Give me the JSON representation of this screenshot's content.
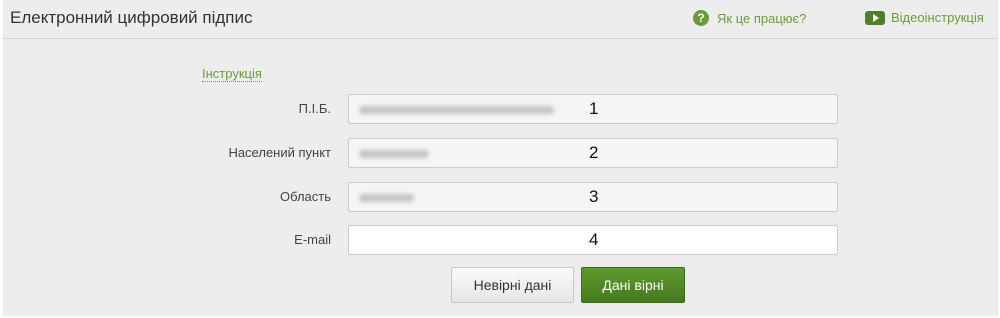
{
  "header": {
    "title": "Електронний цифровий підпис",
    "help_label": "Як це працює?",
    "video_label": "Відеоінструкція"
  },
  "form": {
    "instruction_link": "Інструкція",
    "fields": [
      {
        "label": "П.І.Б.",
        "marker": "1"
      },
      {
        "label": "Населений пункт",
        "marker": "2"
      },
      {
        "label": "Область",
        "marker": "3"
      },
      {
        "label": "E-mail",
        "marker": "4"
      }
    ]
  },
  "buttons": {
    "wrong_label": "Невірні дані",
    "correct_label": "Дані вірні"
  },
  "colors": {
    "accent_green": "#5e9a2f",
    "link_green": "#6e9a3c",
    "panel_bg": "#ededed"
  }
}
